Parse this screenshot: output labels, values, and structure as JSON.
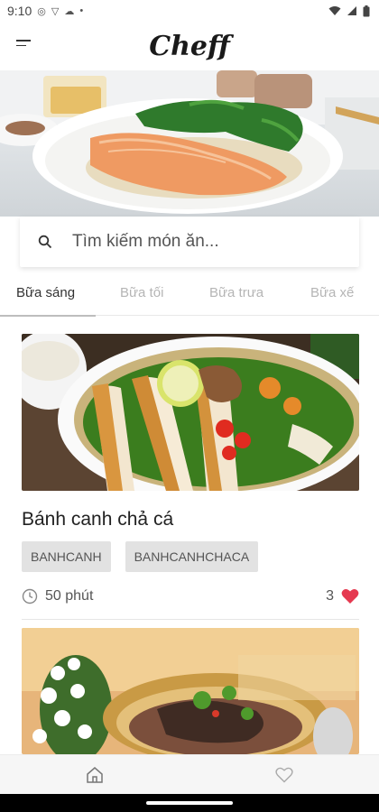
{
  "status_bar": {
    "time": "9:10",
    "icons": [
      "notification-icon",
      "shield-icon",
      "cloud-icon",
      "dot-icon"
    ],
    "right_icons": [
      "wifi-icon",
      "signal-icon",
      "battery-icon"
    ]
  },
  "app_bar": {
    "title": "Cheff",
    "menu_icon": "menu-icon"
  },
  "search": {
    "placeholder": "Tìm kiếm món ăn...",
    "value": ""
  },
  "tabs": [
    {
      "label": "Bữa sáng",
      "active": true
    },
    {
      "label": "Bữa tối",
      "active": false
    },
    {
      "label": "Bữa trưa",
      "active": false
    },
    {
      "label": "Bữa xế",
      "active": false
    }
  ],
  "recipes": [
    {
      "title": "Bánh canh chả cá",
      "tags": [
        "BANHCANH",
        "BANHCANHCHACA"
      ],
      "time": "50 phút",
      "likes": "3"
    },
    {
      "title": "",
      "tags": [],
      "time": "",
      "likes": ""
    }
  ],
  "bottom_nav": {
    "items": [
      "home-icon",
      "heart-icon"
    ]
  },
  "colors": {
    "heart": "#e53950",
    "accent": "#222222",
    "tag_bg": "#e2e2e2"
  }
}
